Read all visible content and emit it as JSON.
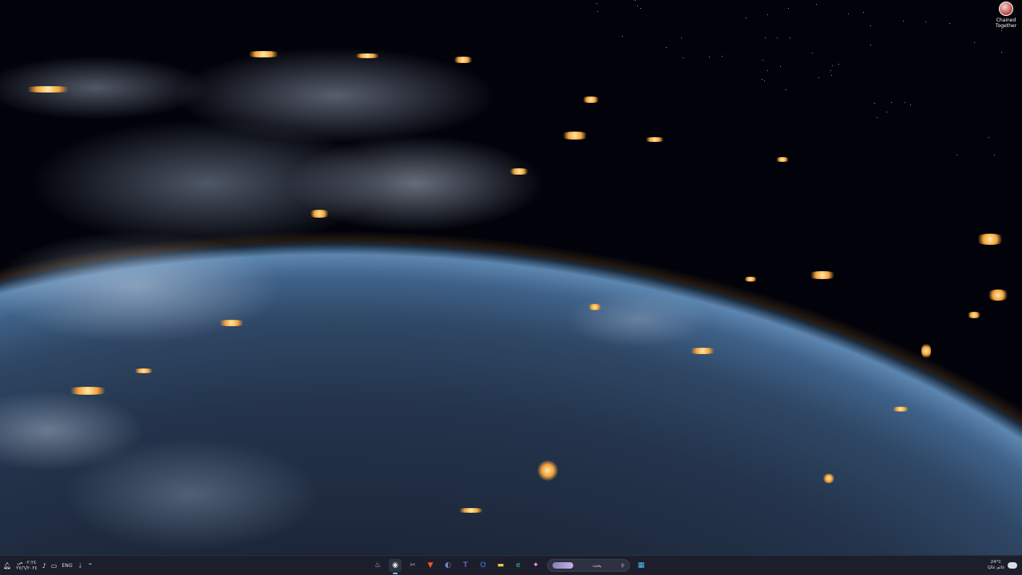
{
  "desktop": {
    "icons": [
      {
        "label": "Chained Together",
        "icon": "chained-together-app-icon"
      }
    ]
  },
  "taskbar": {
    "clock": {
      "time": "٠٢:٢٤ ص",
      "date": "٢٧/٦/٢٠٢٤"
    },
    "tray": {
      "language": "ENG",
      "icons": [
        "notification-icon",
        "volume-icon",
        "network-icon",
        "download-icon",
        "chevron-up-icon"
      ]
    },
    "search": {
      "placeholder": "بحث"
    },
    "apps": [
      {
        "name": "steam",
        "glyph": "♨"
      },
      {
        "name": "obs",
        "glyph": "◉",
        "active": true
      },
      {
        "name": "snipping-tool",
        "glyph": "✂"
      },
      {
        "name": "brave",
        "glyph": "▼"
      },
      {
        "name": "discord",
        "glyph": "◐"
      },
      {
        "name": "teams",
        "glyph": "T"
      },
      {
        "name": "outlook",
        "glyph": "O"
      },
      {
        "name": "file-explorer",
        "glyph": "▬"
      },
      {
        "name": "edge",
        "glyph": "e"
      },
      {
        "name": "copilot",
        "glyph": "✦"
      }
    ],
    "weather": {
      "temp": "24°C",
      "condition": "غائم غالبًا"
    },
    "accent": "#60cdff",
    "background": "#1c1f2b"
  }
}
